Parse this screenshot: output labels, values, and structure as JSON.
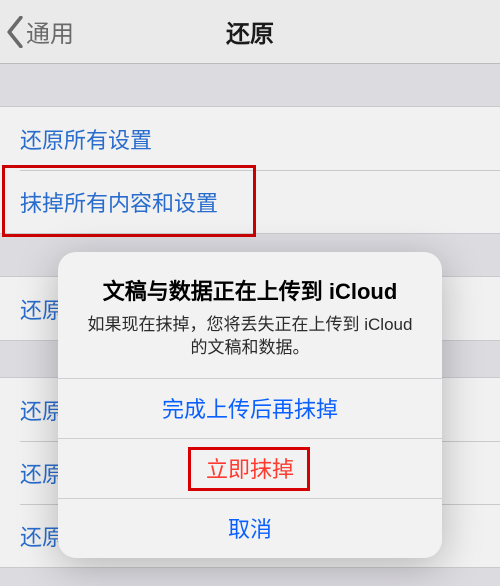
{
  "nav": {
    "back_label": "通用",
    "title": "还原"
  },
  "rows": {
    "reset_all_settings": "还原所有设置",
    "erase_all": "抹掉所有内容和设置",
    "reset_network_prefix": "还原|",
    "reset_keyboard_prefix": "还原",
    "reset_home_prefix": "还原",
    "reset_location_prefix": "还原"
  },
  "alert": {
    "title": "文稿与数据正在上传到 iCloud",
    "message": "如果现在抹掉，您将丢失正在上传到 iCloud 的文稿和数据。",
    "finish_then_erase": "完成上传后再抹掉",
    "erase_now": "立即抹掉",
    "cancel": "取消"
  }
}
